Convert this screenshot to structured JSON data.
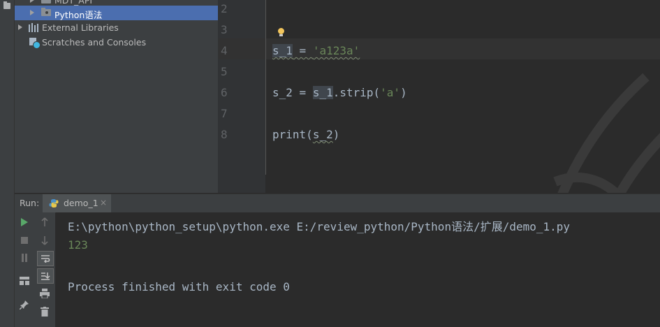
{
  "project_tree": {
    "items": [
      {
        "label": "MDT_API",
        "cut_off": true
      },
      {
        "label": "Python语法",
        "selected": true
      },
      {
        "label": "External Libraries"
      },
      {
        "label": "Scratches and Consoles"
      }
    ]
  },
  "editor": {
    "line_numbers": [
      "2",
      "3",
      "4",
      "5",
      "6",
      "7",
      "8"
    ],
    "current_line": "4",
    "code": {
      "line4": {
        "var": "s_1",
        "op": " = ",
        "str": "'a123a'"
      },
      "line6": {
        "var": "s_2",
        "op": " = ",
        "ref": "s_1",
        "method": ".strip(",
        "arg": "'a'",
        "close": ")"
      },
      "line8": {
        "fn": "print",
        "open": "(",
        "arg": "s_2",
        "close": ")"
      }
    }
  },
  "run_panel": {
    "label": "Run:",
    "tab_label": "demo_1",
    "tab_close": "×",
    "console": {
      "command": "E:\\python\\python_setup\\python.exe E:/review_python/Python语法/扩展/demo_1.py",
      "output": "123",
      "exit_message": "Process finished with exit code 0"
    }
  },
  "colors": {
    "selection": "#4b6eaf",
    "string": "#6a8759",
    "run_green": "#59a869"
  }
}
